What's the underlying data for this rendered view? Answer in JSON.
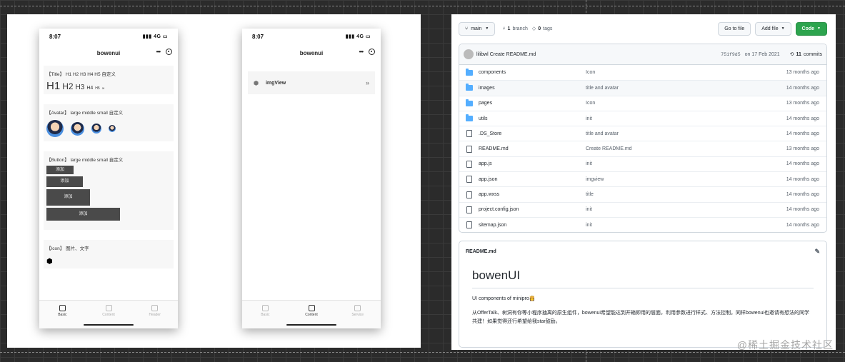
{
  "phone1": {
    "time": "8:07",
    "signal": "4G",
    "title": "bowenui",
    "title_card": {
      "label": "【Title】 H1 H2 H3 H4 H5 自定义",
      "h1": "H1",
      "h2": "H2",
      "h3": "H3",
      "h4": "H4",
      "h5": "H5",
      "extra": "∞"
    },
    "avatar_card": {
      "label": "【Avatar】 large middle small 自定义"
    },
    "button_card": {
      "label": "【Button】 large middle small 自定义",
      "buttons": [
        "添加",
        "添加",
        "添加",
        "添加"
      ]
    },
    "icon_card": {
      "label": "【Icon】 图片、文字"
    },
    "tabs": [
      "Basic",
      "Content",
      "Header"
    ]
  },
  "phone2": {
    "time": "8:07",
    "signal": "4G",
    "title": "bowenui",
    "row_label": "imgView",
    "tabs": [
      "Basic",
      "Content",
      "Service"
    ]
  },
  "github": {
    "branch": "main",
    "branch_count": "1",
    "branch_label": "branch",
    "tag_count": "0",
    "tag_label": "tags",
    "go_to_file": "Go to file",
    "add_file": "Add file",
    "code": "Code",
    "commit": {
      "author": "lilibwl",
      "message": "Create README.md",
      "sha": "751f9d5",
      "date": "on 17 Feb 2021",
      "count": "11",
      "count_label": "commits"
    },
    "files": [
      {
        "type": "folder",
        "name": "components",
        "message": "Icon",
        "age": "13 months ago"
      },
      {
        "type": "folder",
        "name": "images",
        "message": "title and avatar",
        "age": "14 months ago"
      },
      {
        "type": "folder",
        "name": "pages",
        "message": "Icon",
        "age": "13 months ago"
      },
      {
        "type": "folder",
        "name": "utils",
        "message": "init",
        "age": "14 months ago"
      },
      {
        "type": "file",
        "name": ".DS_Store",
        "message": "title and avatar",
        "age": "14 months ago"
      },
      {
        "type": "file",
        "name": "README.md",
        "message": "Create README.md",
        "age": "13 months ago"
      },
      {
        "type": "file",
        "name": "app.js",
        "message": "init",
        "age": "14 months ago"
      },
      {
        "type": "file",
        "name": "app.json",
        "message": "imgview",
        "age": "14 months ago"
      },
      {
        "type": "file",
        "name": "app.wxss",
        "message": "title",
        "age": "14 months ago"
      },
      {
        "type": "file",
        "name": "project.config.json",
        "message": "init",
        "age": "14 months ago"
      },
      {
        "type": "file",
        "name": "sitemap.json",
        "message": "init",
        "age": "14 months ago"
      }
    ],
    "readme": {
      "filename": "README.md",
      "title": "bowenUI",
      "subtitle": "UI components of minipro👸",
      "desc": "从OfferTalk、树洞有你等小程序抽离的原生组件，bowenui希望能达到开箱即用的层面，利用参数进行样式、方法控制。同样bowenui也邀请有想法的同学共建！如果觉得还行希望给我star鼓励。"
    }
  },
  "watermark": "@稀土掘金技术社区"
}
